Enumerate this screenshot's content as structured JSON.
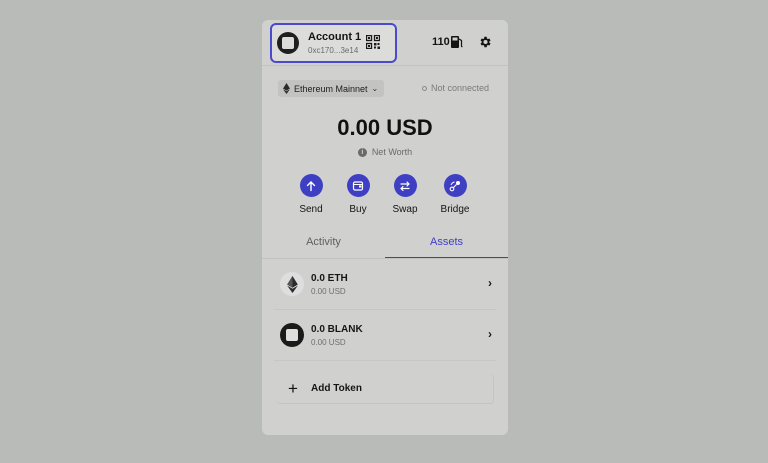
{
  "account": {
    "name": "Account 1",
    "address": "0xc170...3e14"
  },
  "gas": {
    "value": "110"
  },
  "network": {
    "label": "Ethereum Mainnet",
    "status": "Not connected"
  },
  "balance": {
    "value": "0.00 USD",
    "caption": "Net Worth"
  },
  "actions": [
    {
      "label": "Send",
      "icon": "arrow-up-icon"
    },
    {
      "label": "Buy",
      "icon": "wallet-icon"
    },
    {
      "label": "Swap",
      "icon": "swap-icon"
    },
    {
      "label": "Bridge",
      "icon": "bridge-icon"
    }
  ],
  "tabs": [
    {
      "label": "Activity"
    },
    {
      "label": "Assets"
    }
  ],
  "active_tab": "Assets",
  "assets": [
    {
      "amount": "0.0 ETH",
      "usd": "0.00 USD",
      "icon": "eth-icon"
    },
    {
      "amount": "0.0 BLANK",
      "usd": "0.00 USD",
      "icon": "blank-token-icon"
    }
  ],
  "add_token": {
    "label": "Add Token"
  },
  "colors": {
    "accent": "#3f3fc4",
    "background": "#b9bbb8",
    "panel": "#d0d0cf"
  }
}
